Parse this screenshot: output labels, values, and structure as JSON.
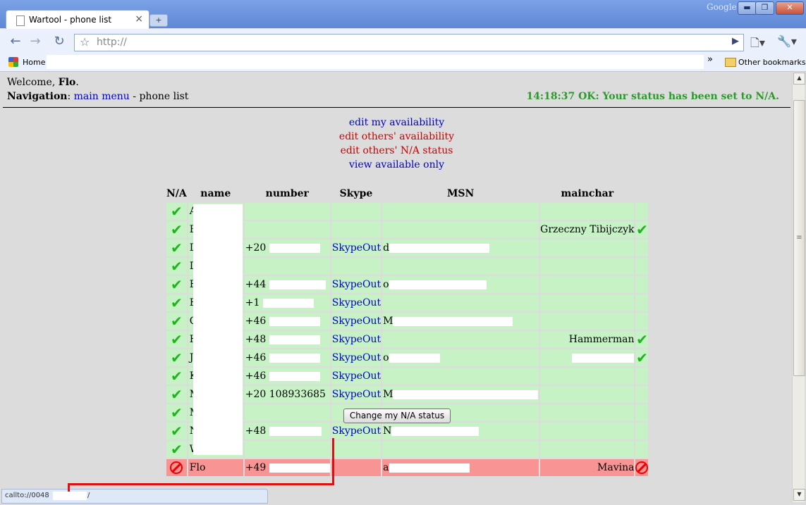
{
  "browser": {
    "tab_title": "Wartool - phone list",
    "tab_close": "×",
    "new_tab": "+",
    "brand": "Google",
    "window_buttons": [
      "▬",
      "❐",
      "✕"
    ],
    "back": "←",
    "forward": "→",
    "reload": "↻",
    "star": "☆",
    "url": "http://",
    "go": "▶",
    "page_menu": "🗋▾",
    "tools_menu": "🔧▾",
    "bookmarks": {
      "home": "Home",
      "more": "»",
      "other": "Other bookmarks"
    }
  },
  "header": {
    "welcome_prefix": "Welcome, ",
    "user": "Flo",
    "welcome_suffix": ".",
    "nav_label": "Navigation",
    "nav_colon": ": ",
    "main_menu": "main menu",
    "nav_sep": " - ",
    "current_page": "phone list",
    "status_message": "14:18:37 OK: Your status has been set to N/A."
  },
  "links": {
    "edit_my": "edit my availability",
    "edit_others": "edit others' availability",
    "edit_others_na": "edit others' N/A status",
    "view_available": "view available only"
  },
  "table": {
    "headers": {
      "na": "N/A",
      "name": "name",
      "number": "number",
      "skype": "Skype",
      "msn": "MSN",
      "mainchar": "mainchar"
    },
    "check_glyph": "✔",
    "rows": [
      {
        "status": "ok",
        "name": "A",
        "number": "",
        "skype": "",
        "msn": "",
        "mainchar": "",
        "main_check": false
      },
      {
        "status": "ok",
        "name": "B",
        "number": "",
        "skype": "",
        "msn": "",
        "mainchar": "Grzeczny Tibijczyk",
        "main_check": true
      },
      {
        "status": "ok",
        "name": "D",
        "number": "+20",
        "skype": "SkypeOut",
        "msn": "d",
        "mainchar": "",
        "main_check": false
      },
      {
        "status": "ok",
        "name": "D",
        "number": "",
        "skype": "",
        "msn": "",
        "mainchar": "",
        "main_check": false
      },
      {
        "status": "ok",
        "name": "E",
        "number": "+44",
        "skype": "SkypeOut",
        "msn": "o",
        "mainchar": "",
        "main_check": false
      },
      {
        "status": "ok",
        "name": "E",
        "number": "+1",
        "skype": "SkypeOut",
        "msn": "",
        "mainchar": "",
        "main_check": false
      },
      {
        "status": "ok",
        "name": "G",
        "number": "+46",
        "skype": "SkypeOut",
        "msn": "M",
        "mainchar": "",
        "main_check": false
      },
      {
        "status": "ok",
        "name": "H",
        "number": "+48",
        "skype": "SkypeOut",
        "msn": "",
        "mainchar": "Hammerman",
        "main_check": true
      },
      {
        "status": "ok",
        "name": "J",
        "number": "+46",
        "skype": "SkypeOut",
        "msn": "o",
        "mainchar": "",
        "main_check": true
      },
      {
        "status": "ok",
        "name": "K",
        "number": "+46",
        "skype": "SkypeOut",
        "msn": "",
        "mainchar": "",
        "main_check": false
      },
      {
        "status": "ok",
        "name": "M",
        "number": "+20 108933685",
        "skype": "SkypeOut",
        "msn": "M",
        "mainchar": "",
        "main_check": false
      },
      {
        "status": "ok",
        "name": "M",
        "number": "",
        "skype": "",
        "msn": "",
        "mainchar": "",
        "main_check": false
      },
      {
        "status": "ok",
        "name": "N",
        "number": "+48",
        "skype": "SkypeOut",
        "msn": "N",
        "mainchar": "",
        "main_check": false
      },
      {
        "status": "ok",
        "name": "W",
        "number": "",
        "skype": "",
        "msn": "",
        "mainchar": "",
        "main_check": false
      },
      {
        "status": "na",
        "name": "Flo",
        "number": "+49",
        "skype": "",
        "msn": "a",
        "mainchar": "Mavina",
        "main_check": false
      }
    ]
  },
  "change_button": "Change my N/A status",
  "statusbar": {
    "prefix": "callto://0048",
    "suffix": "/"
  },
  "colors": {
    "available": "#c6f2c6",
    "na": "#f89494",
    "ok_text": "#2a9a2a",
    "link": "#0000cc",
    "link_red": "#cc0000",
    "annotation": "#e01010"
  }
}
